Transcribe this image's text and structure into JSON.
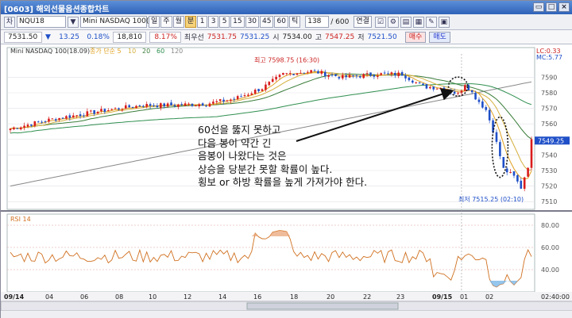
{
  "window": {
    "title": "[0603] 해외선물옵션종합차트",
    "buttons": [
      "▭",
      "□",
      "×"
    ]
  },
  "toolbar": {
    "chart_icon": "차",
    "symbol": "NQU18",
    "search_icon": "▼",
    "product_name": "Mini NASDAQ 100(18.09)",
    "period_buttons": [
      "일",
      "주",
      "월",
      "분",
      "1",
      "3",
      "5",
      "15",
      "30",
      "45",
      "60",
      "틱"
    ],
    "selected_period": "분",
    "count_value": "138",
    "count_total": "/ 600",
    "link_label": "연결",
    "tool_icons": [
      "☑",
      "⚙",
      "▤",
      "▦",
      "✎",
      "▣"
    ]
  },
  "quote": {
    "price": "7531.50",
    "change_arrow": "▼",
    "change": "13.25",
    "change_pct": "0.18%",
    "volume": "18,810",
    "volume_pct": "8.17%",
    "best_label": "최우선",
    "best_price": "7531.75",
    "best_price2": "7531.25",
    "open_label": "시",
    "open": "7534.00",
    "high_label": "고",
    "high": "7547.25",
    "low_label": "저",
    "low": "7521.50",
    "buy_label": "매수",
    "sell_label": "매도"
  },
  "chart_data": [
    {
      "type": "candlestick",
      "title": "Mini NASDAQ 100(18.09)",
      "legend": [
        "Mini NASDAQ 100(18.09)",
        "종가 단순 5",
        "10",
        "20",
        "60",
        "120"
      ],
      "high_annotation": "최고 7598.75 (16:30)",
      "low_annotation": "최저 7515.25 (02:10)",
      "y_ticks": [
        7590,
        7580,
        7570,
        7560,
        7550,
        7540,
        7530,
        7520,
        7510
      ],
      "ylim": [
        7505,
        7605
      ],
      "last_price_tag": "7549.25",
      "ref_lines": [
        "LC:0.33",
        "MC:5.77"
      ],
      "x_labels": [
        "09/14",
        "04",
        "06",
        "08",
        "10",
        "12",
        "14",
        "16",
        "18",
        "20",
        "22",
        "23",
        "09/15",
        "01",
        "02",
        "02:40:00"
      ]
    },
    {
      "type": "line",
      "title": "RSI 14",
      "y_ticks": [
        80,
        60,
        40
      ],
      "ylim": [
        20,
        90
      ]
    }
  ],
  "annotation": {
    "lines": [
      "60선을 뚫지 못하고",
      "다음 봉이 약간 긴",
      "음봉이 나왔다는 것은",
      "상승을 당분간 못할 확률이 높다.",
      "횡보 or 하방 확률을 높게 가져가야 한다."
    ]
  },
  "colors": {
    "up": "#d91c1c",
    "down": "#1f4fc8",
    "ma5": "#e0a020",
    "ma10": "#d4b040",
    "ma20": "#3a7d3a",
    "ma60": "#2f8f4f",
    "ma120": "#888888",
    "rsi": "#d07020"
  }
}
